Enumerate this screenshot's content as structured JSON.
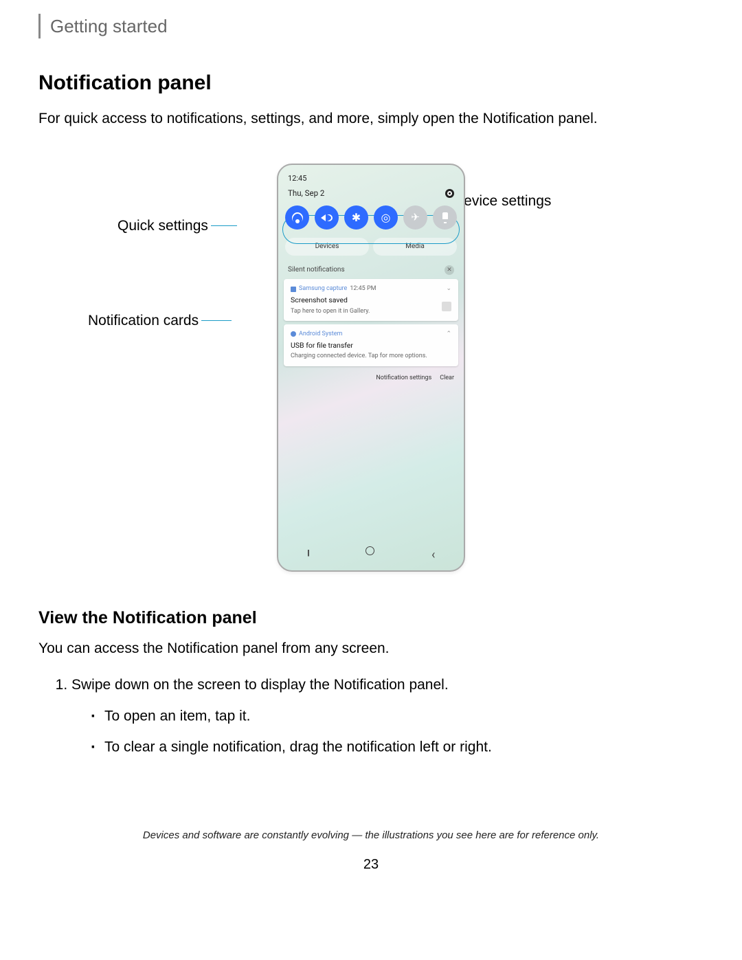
{
  "breadcrumb": "Getting started",
  "heading": "Notification panel",
  "intro": "For quick access to notifications, settings, and more, simply open the Notification panel.",
  "callouts": {
    "quick_settings": "Quick settings",
    "notification_cards": "Notification cards",
    "device_settings": "Device settings"
  },
  "phone": {
    "time": "12:45",
    "date": "Thu, Sep 2",
    "quick_icons": [
      {
        "name": "wifi-icon",
        "on": true
      },
      {
        "name": "volume-icon",
        "on": true
      },
      {
        "name": "bluetooth-icon",
        "on": true
      },
      {
        "name": "rotate-icon",
        "on": true
      },
      {
        "name": "airplane-icon",
        "on": false
      },
      {
        "name": "flashlight-icon",
        "on": false
      }
    ],
    "tabs": {
      "devices": "Devices",
      "media": "Media"
    },
    "silent_label": "Silent notifications",
    "notif1": {
      "app": "Samsung capture",
      "timestamp": "12:45 PM",
      "title": "Screenshot saved",
      "subtitle": "Tap here to open it in Gallery."
    },
    "notif2": {
      "app": "Android System",
      "title": "USB for file transfer",
      "subtitle": "Charging connected device. Tap for more options."
    },
    "links": {
      "settings": "Notification settings",
      "clear": "Clear"
    }
  },
  "section2_heading": "View the Notification panel",
  "section2_intro": "You can access the Notification panel from any screen.",
  "steps": {
    "s1": "Swipe down on the screen to display the Notification panel.",
    "s1a": "To open an item, tap it.",
    "s1b": "To clear a single notification, drag the notification left or right."
  },
  "footer_note": "Devices and software are constantly evolving — the illustrations you see here are for reference only.",
  "page_number": "23"
}
